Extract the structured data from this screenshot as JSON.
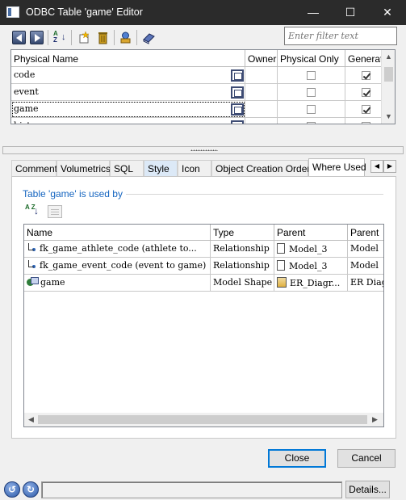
{
  "window": {
    "title": "ODBC Table 'game' Editor",
    "minimize_glyph": "—",
    "maximize_glyph": "☐",
    "close_glyph": "✕"
  },
  "toolbar": {
    "icons": [
      "prev-icon",
      "next-icon",
      "sort-icon",
      "new-icon",
      "delete-icon",
      "reuse-icon",
      "book-icon"
    ],
    "filter_placeholder": "Enter filter text"
  },
  "columns_grid": {
    "headers": [
      "Physical Name",
      "Owner",
      "Physical Only",
      "Generat"
    ],
    "rows": [
      {
        "name": "code",
        "owner": "",
        "physical_only": false,
        "generate": true
      },
      {
        "name": "event",
        "owner": "",
        "physical_only": false,
        "generate": true
      },
      {
        "name": "game",
        "owner": "",
        "physical_only": false,
        "generate": true
      },
      {
        "name": "history",
        "owner": "",
        "physical_only": false,
        "generate": true
      }
    ]
  },
  "tabs": [
    {
      "label": "Comment"
    },
    {
      "label": "Volumetrics"
    },
    {
      "label": "SQL"
    },
    {
      "label": "Style"
    },
    {
      "label": "Icon"
    },
    {
      "label": "Object Creation Order"
    },
    {
      "label": "Where Used"
    }
  ],
  "where_used": {
    "heading": "Table 'game' is used by",
    "sort_label": "A Z",
    "headers": [
      "Name",
      "Type",
      "Parent",
      "Parent"
    ],
    "rows": [
      {
        "icon": "relationship-icon",
        "name": "fk_game_athlete_code (athlete to...",
        "type": "Relationship",
        "parent_icon": "document-icon",
        "parent": "Model_3",
        "parent2": "Model"
      },
      {
        "icon": "relationship-icon",
        "name": "fk_game_event_code (event to game)",
        "type": "Relationship",
        "parent_icon": "document-icon",
        "parent": "Model_3",
        "parent2": "Model"
      },
      {
        "icon": "model-shape-icon",
        "name": "game",
        "type": "Model Shape",
        "parent_icon": "er-diagram-icon",
        "parent": "ER_Diagr...",
        "parent2": "ER Diag"
      }
    ]
  },
  "buttons": {
    "close": "Close",
    "cancel": "Cancel",
    "details": "Details..."
  },
  "status": {
    "text": "",
    "back_glyph": "↺",
    "forward_glyph": "↻"
  }
}
